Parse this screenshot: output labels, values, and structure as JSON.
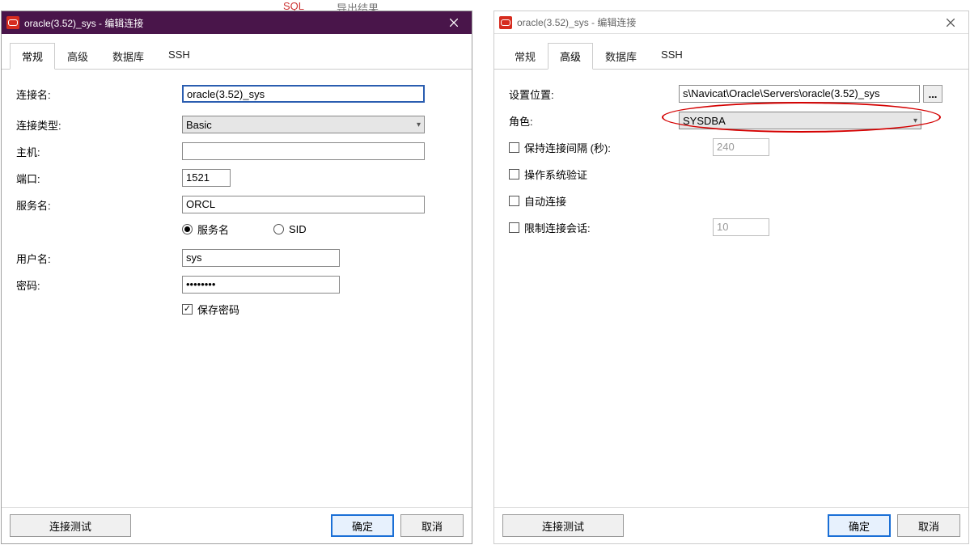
{
  "top_fragments": {
    "sql": "SQL",
    "result": "导出结果"
  },
  "left": {
    "title": "oracle(3.52)_sys - 编辑连接",
    "tabs": [
      "常规",
      "高级",
      "数据库",
      "SSH"
    ],
    "active_tab": 0,
    "labels": {
      "conn_name": "连接名:",
      "conn_type": "连接类型:",
      "host": "主机:",
      "port": "端口:",
      "service_name": "服务名:",
      "username": "用户名:",
      "password": "密码:",
      "save_password": "保存密码"
    },
    "values": {
      "conn_name": "oracle(3.52)_sys",
      "conn_type": "Basic",
      "host": "   ",
      "port": "1521",
      "service_name": "ORCL",
      "username": "sys",
      "password": "••••••••"
    },
    "radio": {
      "service_name": "服务名",
      "sid": "SID",
      "selected": "service_name"
    },
    "save_password_checked": true,
    "buttons": {
      "test": "连接测试",
      "ok": "确定",
      "cancel": "取消"
    }
  },
  "right": {
    "title": "oracle(3.52)_sys - 编辑连接",
    "tabs": [
      "常规",
      "高级",
      "数据库",
      "SSH"
    ],
    "active_tab": 1,
    "labels": {
      "setting_loc": "设置位置:",
      "role": "角色:",
      "keep_alive": "保持连接间隔 (秒):",
      "os_auth": "操作系统验证",
      "auto_connect": "自动连接",
      "limit_sessions": "限制连接会话:"
    },
    "values": {
      "setting_loc": "s\\Navicat\\Oracle\\Servers\\oracle(3.52)_sys",
      "role": "SYSDBA",
      "keep_alive": "240",
      "limit_sessions": "10"
    },
    "checks": {
      "keep_alive": false,
      "os_auth": false,
      "auto_connect": false,
      "limit_sessions": false
    },
    "browse": "...",
    "buttons": {
      "test": "连接测试",
      "ok": "确定",
      "cancel": "取消"
    }
  }
}
